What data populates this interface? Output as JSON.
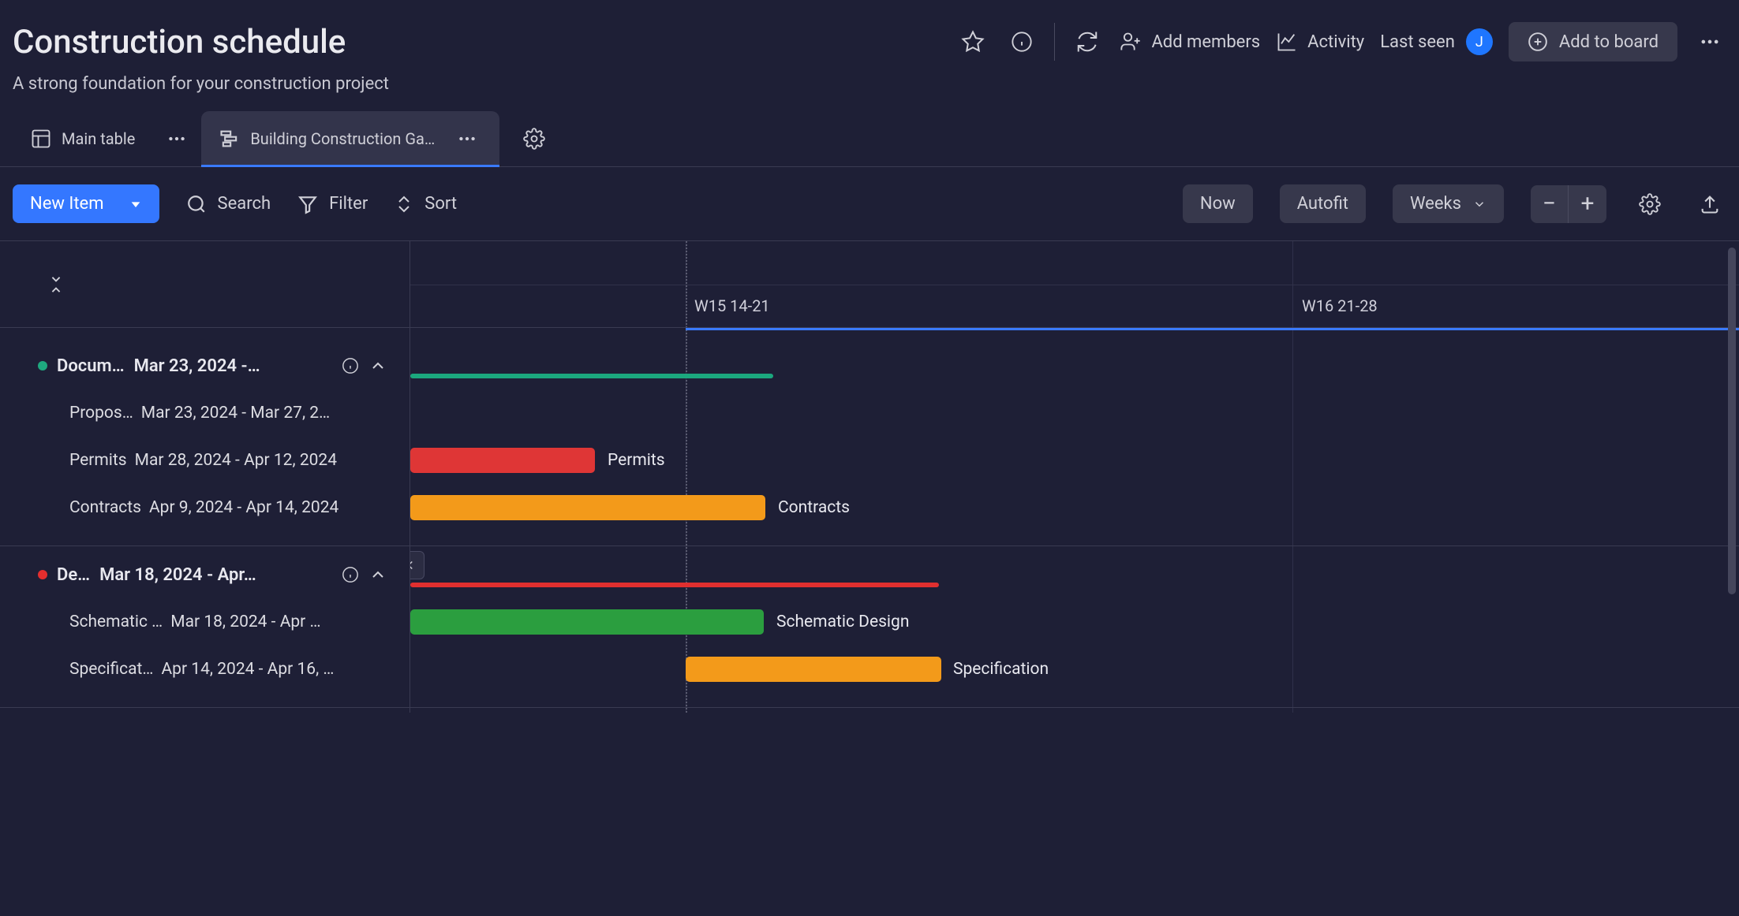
{
  "header": {
    "title": "Construction schedule",
    "subtitle": "A strong foundation for your construction project",
    "add_members_label": "Add members",
    "activity_label": "Activity",
    "last_seen_label": "Last seen",
    "avatar_initial": "J",
    "add_to_board_label": "Add to board"
  },
  "tabs": {
    "main_table_label": "Main table",
    "gantt_label": "Building Construction Ga…"
  },
  "toolbar": {
    "new_item_label": "New Item",
    "search_label": "Search",
    "filter_label": "Filter",
    "sort_label": "Sort",
    "now_label": "Now",
    "autofit_label": "Autofit",
    "timescale_label": "Weeks"
  },
  "timeline": {
    "week15_label": "W15 14-21",
    "week16_label": "W16 21-28"
  },
  "groups": [
    {
      "name": "Docum…",
      "dates": "Mar 23, 2024 -…",
      "color": "green",
      "tasks": [
        {
          "name": "Propos…",
          "dates": "Mar 23, 2024 - Mar 27, 2…"
        },
        {
          "name": "Permits",
          "dates": "Mar 28, 2024 - Apr 12, 2024"
        },
        {
          "name": "Contracts",
          "dates": "Apr 9, 2024 - Apr 14, 2024"
        }
      ]
    },
    {
      "name": "De…",
      "dates": "Mar 18, 2024 - Apr…",
      "color": "red",
      "tasks": [
        {
          "name": "Schematic …",
          "dates": "Mar 18, 2024 - Apr …"
        },
        {
          "name": "Specificat…",
          "dates": "Apr 14, 2024 - Apr 16, …"
        }
      ]
    }
  ],
  "bars": {
    "permits_label": "Permits",
    "contracts_label": "Contracts",
    "schematic_label": "Schematic Design",
    "specification_label": "Specification"
  }
}
